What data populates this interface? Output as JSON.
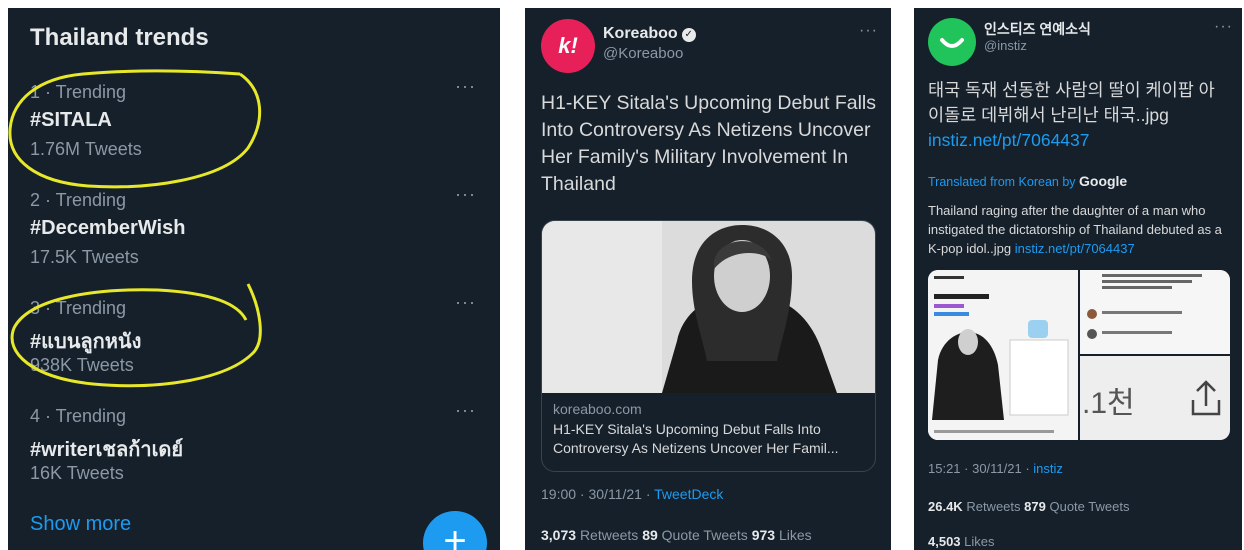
{
  "trends": {
    "title": "Thailand trends",
    "items": [
      {
        "meta": "1 · Trending",
        "tag": "#SITALA",
        "count": "1.76M Tweets"
      },
      {
        "meta": "2 · Trending",
        "tag": "#DecemberWish",
        "count": "17.5K Tweets"
      },
      {
        "meta": "3 · Trending",
        "tag": "#แบนลูกหนัง",
        "count": "938K Tweets"
      },
      {
        "meta": "4 · Trending",
        "tag": "#writerเชลก้าเดย์",
        "count": "16K Tweets"
      }
    ],
    "more_icon": "···",
    "show_more": "Show more",
    "fab_icon": "+"
  },
  "koreaboo": {
    "name": "Koreaboo",
    "handle": "@Koreaboo",
    "avatar_letter": "k!",
    "verified_icon": "✓",
    "more_icon": "···",
    "headline": "H1-KEY Sitala's Upcoming Debut Falls Into Controversy As Netizens Uncover Her Family's Military Involvement In Thailand",
    "card_domain": "koreaboo.com",
    "card_title": "H1-KEY Sitala's Upcoming Debut Falls Into Controversy As Netizens Uncover Her Famil...",
    "time": "19:00 · 30/11/21 · ",
    "source": "TweetDeck",
    "retweets": "3,073",
    "retweets_label": "Retweets",
    "quotes": "89",
    "quotes_label": "Quote Tweets",
    "likes": "973",
    "likes_label": "Likes"
  },
  "instiz": {
    "name": "인스티즈 연예소식",
    "handle": "@instiz",
    "more_icon": "···",
    "korean_text": "태국 독재 선동한 사람의 딸이 케이팝 아이돌로 데뷔해서 난리난 태국..jpg",
    "korean_link": "instiz.net/pt/7064437",
    "translated_prefix": "Translated from Korean by ",
    "translated_brand": "Google",
    "english_text": "Thailand raging after the daughter of a man who instigated the dictatorship of Thailand debuted as a K-pop idol..jpg ",
    "english_link": "instiz.net/pt/7064437",
    "media_overlay_text": ".1천",
    "time": "15:21 · 30/11/21 · ",
    "source": "instiz",
    "retweets": "26.4K",
    "retweets_label": "Retweets",
    "quotes": "879",
    "quotes_label": "Quote Tweets",
    "likes": "4,503",
    "likes_label": "Likes"
  },
  "colors": {
    "background": "#15202b",
    "accent": "#1d9bf0",
    "highlight": "#e8e82a",
    "koreaboo_brand": "#e8205a",
    "instiz_brand": "#21c45a"
  }
}
